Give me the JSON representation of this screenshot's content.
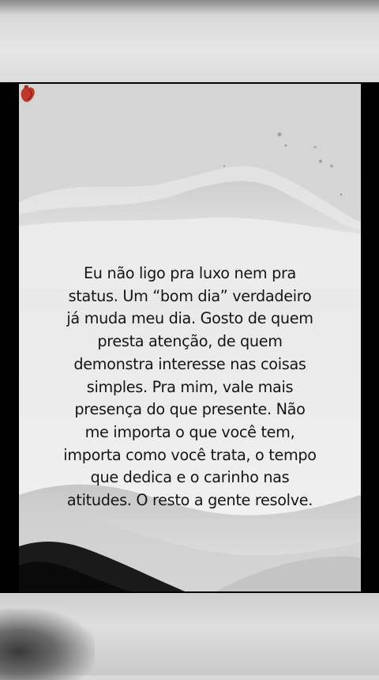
{
  "post": {
    "quote_lines": [
      "Eu não ligo pra luxo nem pra",
      "status. Um “bom dia” verdadeiro",
      "já muda meu dia. Gosto de quem",
      "presta atenção, de quem",
      "demonstra interesse nas coisas",
      "simples. Pra mim, vale mais",
      "presença do que presente. Não",
      "me importa o que você tem,",
      "importa como você trata, o tempo",
      "que dedica e o carinho nas",
      "atitudes. O resto a gente resolve."
    ],
    "icon": "anatomical-heart-icon"
  },
  "colors": {
    "text": "#151515",
    "heart": "#c0392b",
    "background_band": "#000000"
  }
}
